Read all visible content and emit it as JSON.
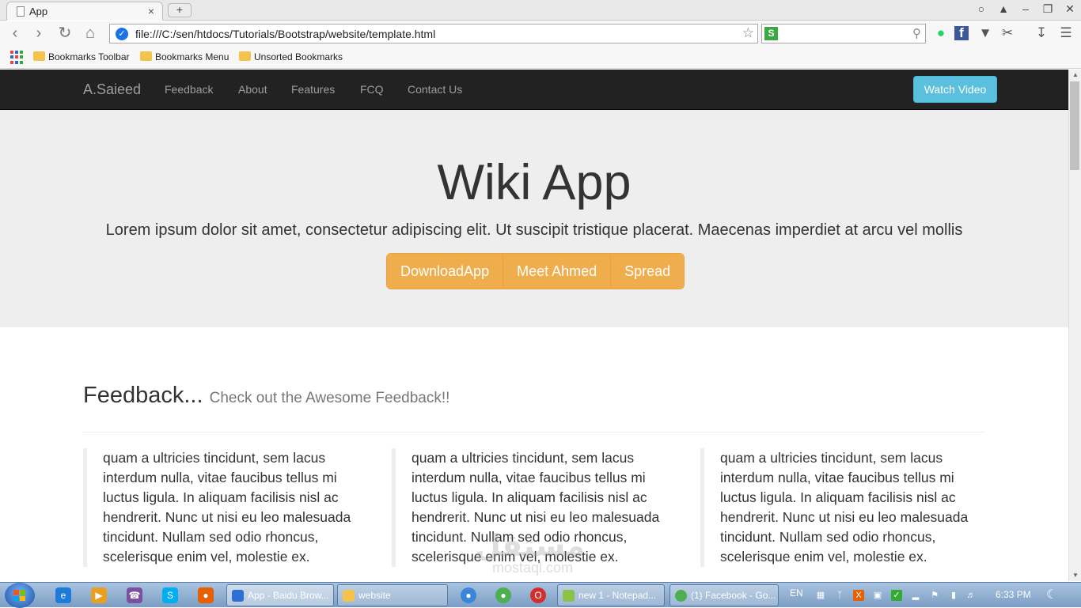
{
  "browser": {
    "tab_title": "App",
    "tab_close": "×",
    "new_tab": "+",
    "url": "file:///C:/sen/htdocs/Tutorials/Bootstrap/website/template.html",
    "bookmarks": [
      "Bookmarks Toolbar",
      "Bookmarks Menu",
      "Unsorted Bookmarks"
    ]
  },
  "site": {
    "brand": "A.Saieed",
    "nav": [
      "Feedback",
      "About",
      "Features",
      "FCQ",
      "Contact Us"
    ],
    "watch_button": "Watch Video",
    "hero": {
      "title": "Wiki App",
      "lead": "Lorem ipsum dolor sit amet, consectetur adipiscing elit. Ut suscipit tristique placerat. Maecenas imperdiet at arcu vel mollis",
      "buttons": [
        "DownloadApp",
        "Meet Ahmed",
        "Spread"
      ]
    },
    "feedback": {
      "heading": "Feedback...",
      "subheading": "Check out the Awesome Feedback!!",
      "quotes": [
        "quam a ultricies tincidunt, sem lacus interdum nulla, vitae faucibus tellus mi luctus ligula. In aliquam facilisis nisl ac hendrerit. Nunc ut nisi eu leo malesuada tincidunt. Nullam sed odio rhoncus, scelerisque enim vel, molestie ex.",
        "quam a ultricies tincidunt, sem lacus interdum nulla, vitae faucibus tellus mi luctus ligula. In aliquam facilisis nisl ac hendrerit. Nunc ut nisi eu leo malesuada tincidunt. Nullam sed odio rhoncus, scelerisque enim vel, molestie ex.",
        "quam a ultricies tincidunt, sem lacus interdum nulla, vitae faucibus tellus mi luctus ligula. In aliquam facilisis nisl ac hendrerit. Nunc ut nisi eu leo malesuada tincidunt. Nullam sed odio rhoncus, scelerisque enim vel, molestie ex."
      ]
    },
    "watermark": "مستقل",
    "watermark_sub": "mostaql.com"
  },
  "taskbar": {
    "windows": [
      "App - Baidu Brow...",
      "website",
      "new 1 - Notepad...",
      "(1) Facebook - Go..."
    ],
    "language": "EN",
    "clock": "6:33 PM"
  },
  "colors": {
    "navbar_bg": "#222222",
    "jumbotron_bg": "#eeeeee",
    "warning": "#f0ad4e",
    "info": "#5bc0de"
  }
}
